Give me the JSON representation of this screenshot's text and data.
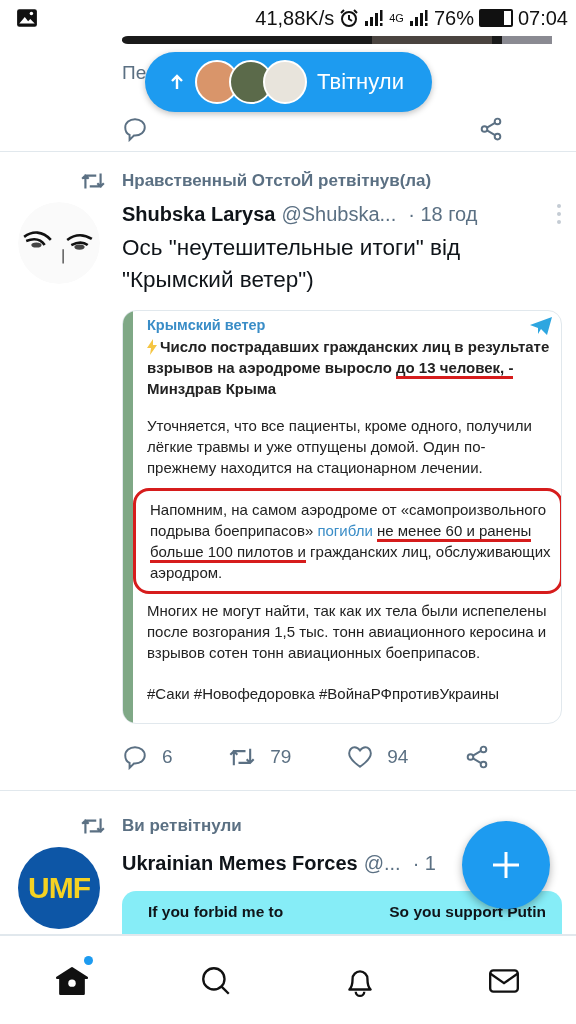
{
  "status_bar": {
    "speed": "41,88K/s",
    "network": "4G",
    "battery_text": "76%",
    "time": "07:04"
  },
  "new_tweets_pill": {
    "label": "Твітнули"
  },
  "previous_tweet": {
    "text_fragment": "Пе"
  },
  "tweets": [
    {
      "retweeted_by": "Нравственный ОтстоЙ ретвітнув(ла)",
      "name": "Shubska Larysa",
      "handle": "@Shubska...",
      "time": "· 18 год",
      "text": "Ось \"неутешительные итоги\" від \"Крымский ветер\")",
      "media": {
        "kind": "telegram_post",
        "channel": "Крымский ветер",
        "paragraphs": [
          {
            "kind": "bold",
            "parts": [
              {
                "kind": "plain",
                "text": "Число пострадавших гражданских лиц в результате взрывов на аэродроме выросло"
              },
              {
                "kind": "underlined",
                "text": "до 13 человек, -"
              },
              {
                "kind": "plain",
                "text": "Минздрав Крыма"
              }
            ]
          },
          {
            "kind": "plain",
            "parts": [
              {
                "kind": "plain",
                "text": "Уточняется, что все пациенты, кроме одного, получили лёгкие травмы и уже отпущены домой. Один по-прежнему находится на стационарном лечении."
              }
            ]
          },
          {
            "kind": "circled",
            "parts": [
              {
                "kind": "plain",
                "text": "Напомним, на самом аэродроме от «самопроизвольного подрыва боеприпасов»"
              },
              {
                "kind": "link",
                "text": "погибли"
              },
              {
                "kind": "underlined",
                "text": "не менее 60 и ранены больше 100 пилотов и"
              },
              {
                "kind": "plain",
                "text": "гражданских лиц, обслуживающих аэродром."
              }
            ]
          },
          {
            "kind": "plain",
            "parts": [
              {
                "kind": "plain",
                "text": "Многих не могут найти, так как их тела были испепелены после возгорания 1,5 тыс. тонн авиационного керосина и взрывов сотен тонн авиационных боеприпасов."
              }
            ]
          },
          {
            "kind": "plain",
            "parts": [
              {
                "kind": "plain",
                "text": "#Саки #Новофедоровка #ВойнаРФпротивУкраины"
              }
            ]
          }
        ]
      },
      "replies": "6",
      "retweets": "79",
      "likes": "94"
    },
    {
      "retweeted_by": "Ви ретвітнули",
      "avatar_text": "UMF",
      "name": "Ukrainian Memes Forces",
      "handle": "@...",
      "time": "· 1",
      "media": {
        "kind": "meme",
        "captions": [
          "If you forbid me to",
          "So you support Putin"
        ]
      }
    }
  ],
  "bottom_nav": [
    {
      "selected": true,
      "badge": true
    },
    {
      "selected": false,
      "badge": false
    },
    {
      "selected": false,
      "badge": false
    },
    {
      "selected": false,
      "badge": false
    }
  ]
}
